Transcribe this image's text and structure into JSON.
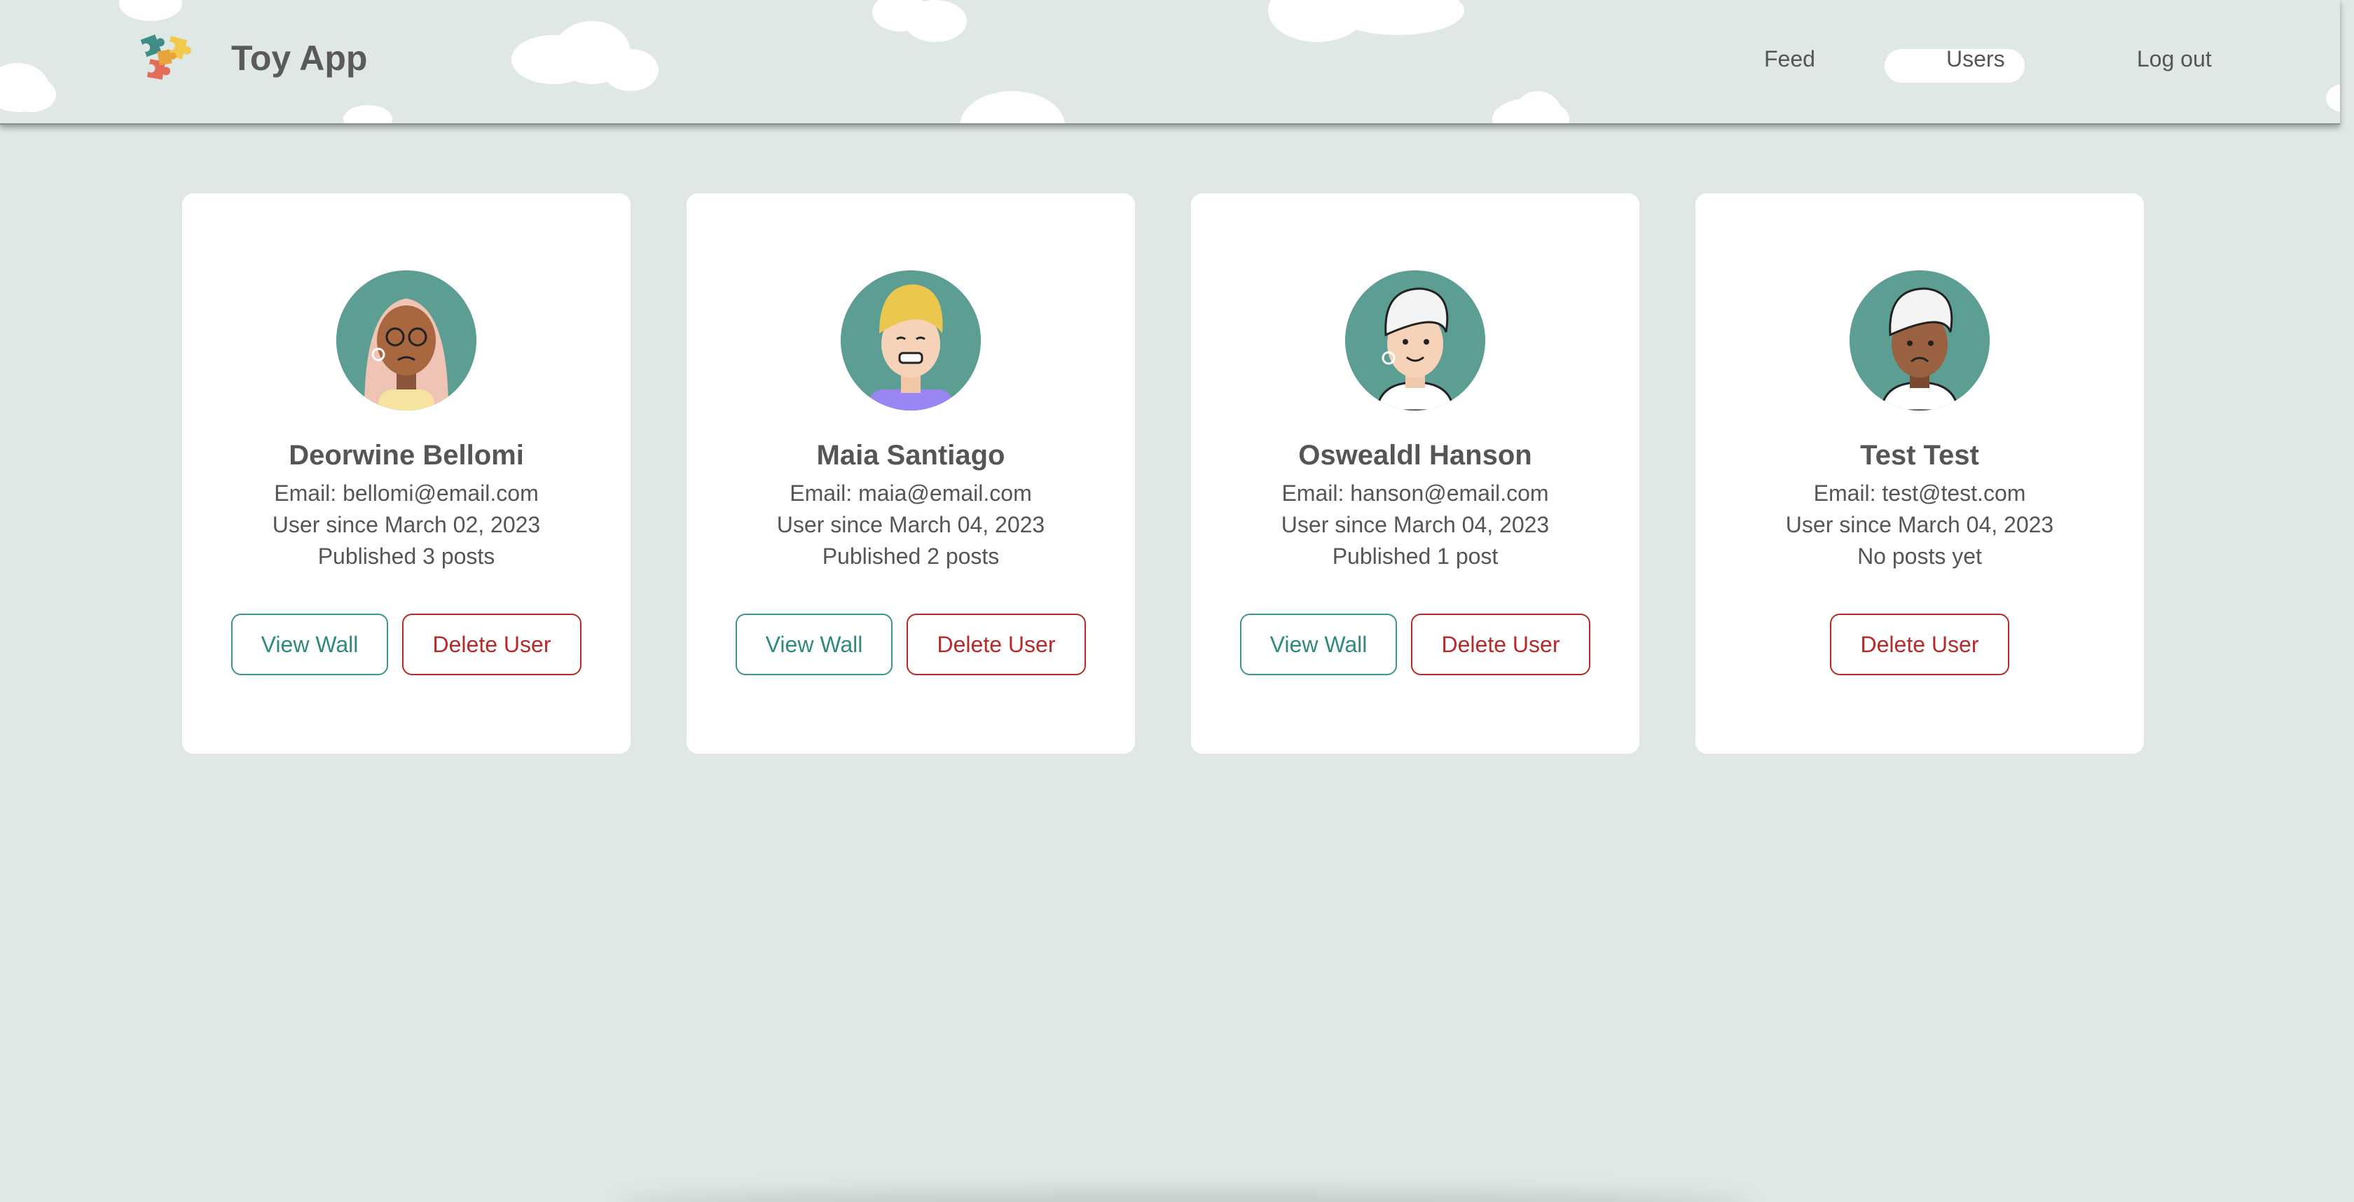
{
  "header": {
    "brand": "Toy App",
    "nav": {
      "feed": "Feed",
      "users": "Users",
      "logout": "Log out"
    }
  },
  "colors": {
    "background": "#dfe8e5",
    "avatar_bg": "#5c9d94",
    "view_accent": "#3d958a",
    "delete_accent": "#b62a2a"
  },
  "users": [
    {
      "name": "Deorwine Bellomi",
      "email": "Email: bellomi@email.com",
      "since": "User since March 02, 2023",
      "posts": "Published 3 posts",
      "view_label": "View Wall",
      "delete_label": "Delete User",
      "avatar": "avatar-woman-glasses"
    },
    {
      "name": "Maia Santiago",
      "email": "Email: maia@email.com",
      "since": "User since March 04, 2023",
      "posts": "Published 2 posts",
      "view_label": "View Wall",
      "delete_label": "Delete User",
      "avatar": "avatar-blonde-grimace"
    },
    {
      "name": "Oswealdl Hanson",
      "email": "Email: hanson@email.com",
      "since": "User since March 04, 2023",
      "posts": "Published 1 post",
      "view_label": "View Wall",
      "delete_label": "Delete User",
      "avatar": "avatar-white-hair-smile"
    },
    {
      "name": "Test Test",
      "email": "Email: test@test.com",
      "since": "User since March 04, 2023",
      "posts": "No posts yet",
      "delete_label": "Delete User",
      "avatar": "avatar-white-hair-sad"
    }
  ]
}
